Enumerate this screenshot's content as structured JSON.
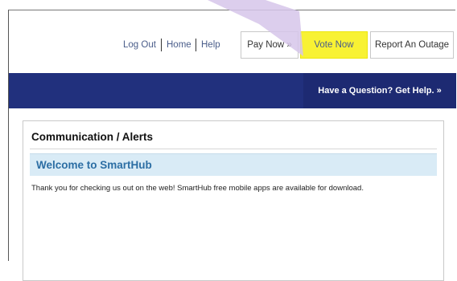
{
  "header": {
    "links": {
      "logout": "Log Out",
      "home": "Home",
      "help": "Help"
    },
    "buttons": {
      "pay_now": "Pay Now »",
      "vote_now": "Vote Now",
      "report_outage": "Report An Outage"
    }
  },
  "banner": {
    "cta": "Have a Question? Get Help. »"
  },
  "panel": {
    "title": "Communication / Alerts",
    "welcome": "Welcome to SmartHub",
    "message": "Thank you for checking us out on the web! SmartHub free mobile apps are available for download."
  },
  "colors": {
    "banner": "#21307d",
    "highlight": "#f8f233",
    "annotation_arrow": "#d6c6ea",
    "link": "#4a5d8a",
    "welcome_bg": "#d9ebf6"
  }
}
